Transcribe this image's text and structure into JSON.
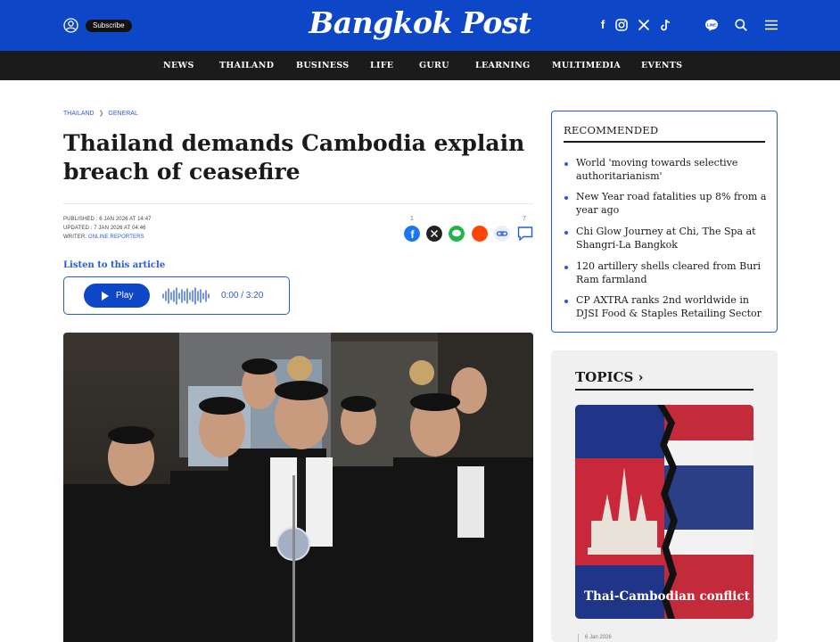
{
  "header": {
    "logo": "Bangkok Post",
    "subscribe_label": "Subscribe"
  },
  "social_icons": [
    "facebook-icon",
    "instagram-icon",
    "x-icon",
    "tiktok-icon"
  ],
  "nav": {
    "items": [
      "NEWS",
      "THAILAND",
      "BUSINESS",
      "LIFE",
      "GURU",
      "LEARNING",
      "MULTIMEDIA",
      "EVENTS"
    ]
  },
  "breadcrumb": {
    "section": "THAILAND",
    "separator": "❯",
    "subsection": "GENERAL"
  },
  "article": {
    "headline": "Thailand demands Cambodia explain breach of ceasefire",
    "published": "PUBLISHED : 6 JAN 2026 AT 14:47",
    "updated": "UPDATED : 7 JAN 2026 AT 04:46",
    "writer_label": "WRITER: ",
    "writer": "ONLINE REPORTERS",
    "share_count_facebook": "1",
    "share_count_comments": "7"
  },
  "audio": {
    "listen_label": "Listen to this article",
    "play_label": "Play",
    "time": "0:00 / 3:20"
  },
  "recommended": {
    "title": "RECOMMENDED",
    "items": [
      "World 'moving towards selective authoritarianism'",
      "New Year road fatalities up 8% from a year ago",
      "Chi Glow Journey at Chi, The Spa at Shangri-La Bangkok",
      "120 artillery shells cleared from Buri Ram farmland",
      "CP AXTRA ranks 2nd worldwide in DJSI Food & Staples Retailing Sector"
    ]
  },
  "topics": {
    "title": "TOPICS",
    "arrow": "›",
    "card_label": "Thai-Cambodian conflict",
    "date": "6 Jan 2026"
  },
  "colors": {
    "brand_blue": "#0d47c8",
    "nav_bg": "#1b1b1b",
    "link_blue": "#2a5bd7"
  }
}
